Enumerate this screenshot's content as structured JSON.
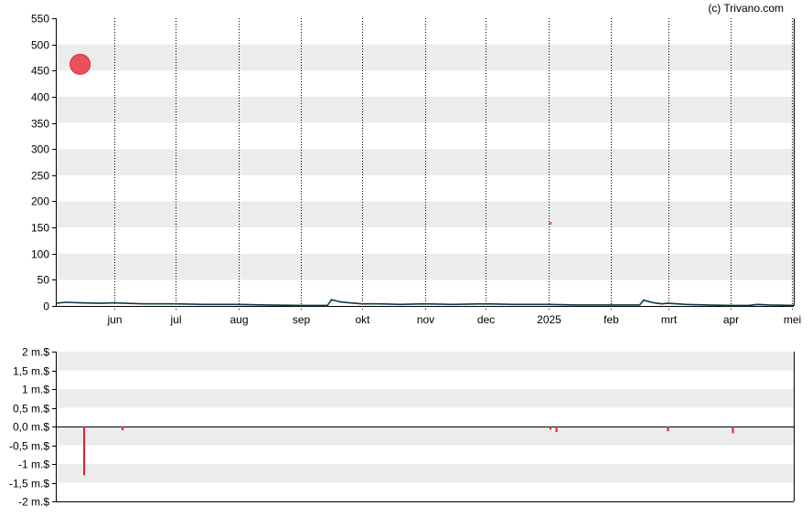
{
  "credit": "(c) Trivano.com",
  "colors": {
    "band": "#ececec",
    "price_line": "#0d3b46",
    "marker": "#e8505a",
    "bar": "#dd1c2c",
    "axis": "#000000"
  },
  "chart_data": [
    {
      "type": "line",
      "name": "price-chart",
      "ylim": [
        0,
        550
      ],
      "yticks": [
        0,
        50,
        100,
        150,
        200,
        250,
        300,
        350,
        400,
        450,
        500,
        550
      ],
      "ytick_labels": [
        "0",
        "50",
        "100",
        "150",
        "200",
        "250",
        "300",
        "350",
        "400",
        "450",
        "500",
        "550"
      ],
      "xlim": [
        "2024-05-03",
        "2025-05-02"
      ],
      "xticks": [
        "2024-06-01",
        "2024-07-01",
        "2024-08-01",
        "2024-09-01",
        "2024-10-01",
        "2024-11-01",
        "2024-12-01",
        "2025-01-01",
        "2025-02-01",
        "2025-03-01",
        "2025-04-01",
        "2025-05-01"
      ],
      "xtick_labels": [
        "jun",
        "jul",
        "aug",
        "sep",
        "okt",
        "nov",
        "dec",
        "2025",
        "feb",
        "mrt",
        "apr",
        "mei"
      ],
      "grid": "vertical-dotted",
      "x": [
        "2024-05-03",
        "2024-05-08",
        "2024-05-15",
        "2024-05-25",
        "2024-06-01",
        "2024-06-15",
        "2024-07-01",
        "2024-07-15",
        "2024-08-01",
        "2024-08-15",
        "2024-09-01",
        "2024-09-10",
        "2024-09-14",
        "2024-09-16",
        "2024-09-20",
        "2024-09-25",
        "2024-10-01",
        "2024-10-10",
        "2024-10-20",
        "2024-11-01",
        "2024-11-15",
        "2024-12-01",
        "2024-12-15",
        "2025-01-01",
        "2025-01-15",
        "2025-02-01",
        "2025-02-10",
        "2025-02-15",
        "2025-02-17",
        "2025-02-22",
        "2025-02-26",
        "2025-03-01",
        "2025-03-10",
        "2025-03-20",
        "2025-04-01",
        "2025-04-10",
        "2025-04-14",
        "2025-04-20",
        "2025-05-02"
      ],
      "y": [
        5,
        7,
        6,
        5,
        6,
        4,
        4,
        3,
        3,
        2,
        1,
        1,
        1,
        12,
        8,
        6,
        4,
        4,
        3,
        4,
        3,
        4,
        3,
        3,
        2,
        2,
        2,
        2,
        11,
        6,
        4,
        5,
        3,
        2,
        1,
        1,
        3,
        2,
        1
      ],
      "markers": [
        {
          "date": "2024-05-15",
          "value": 462,
          "size": "large"
        },
        {
          "date": "2025-01-02",
          "value": 158,
          "size": "small"
        }
      ]
    },
    {
      "type": "bar",
      "name": "volume-chart",
      "ylim": [
        -2,
        2
      ],
      "yticks": [
        -2,
        -1.5,
        -1,
        -0.5,
        0,
        0.5,
        1,
        1.5,
        2
      ],
      "ytick_labels": [
        "-2 m.$",
        "-1,5 m.$",
        "-1 m.$",
        "-0,5 m.$",
        "0,0 m.$",
        "0,5 m.$",
        "1 m.$",
        "1,5 m.$",
        "2 m.$"
      ],
      "xlim": [
        "2024-05-03",
        "2025-05-02"
      ],
      "x": [
        "2024-05-17",
        "2024-06-05",
        "2025-01-02",
        "2025-01-05",
        "2025-03-01",
        "2025-04-02"
      ],
      "values": [
        -1.3,
        -0.1,
        -0.08,
        -0.15,
        -0.13,
        -0.18
      ]
    }
  ]
}
